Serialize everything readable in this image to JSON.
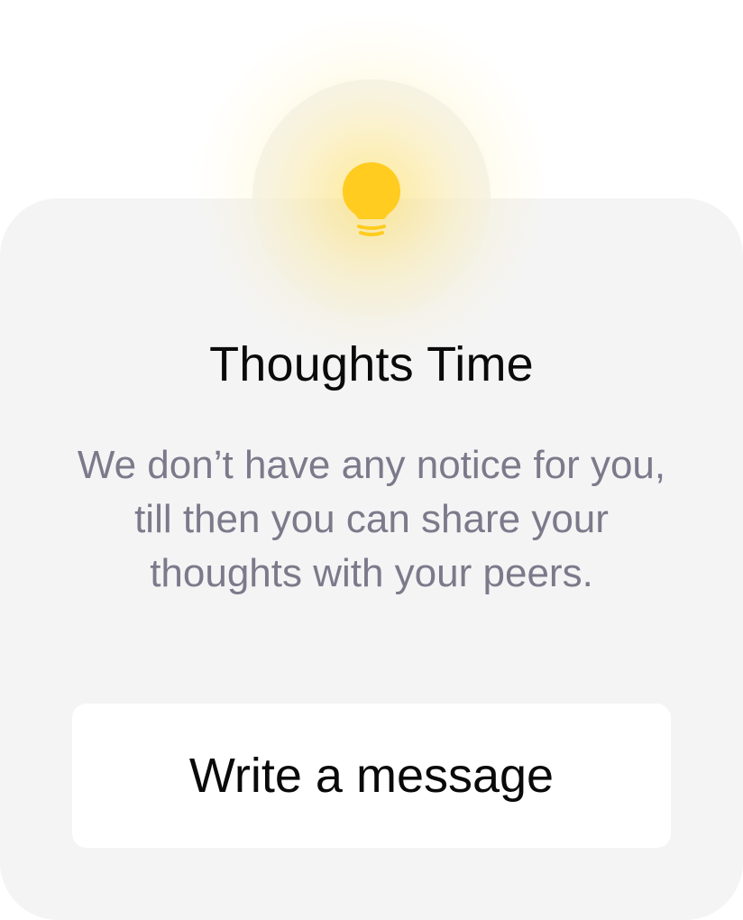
{
  "empty_state": {
    "icon": "lightbulb-icon",
    "accent_color": "#FFCC1F",
    "title": "Thoughts Time",
    "message": "We don’t have any notice for you, till then you can share your thoughts with your peers.",
    "button_label": "Write a message"
  }
}
